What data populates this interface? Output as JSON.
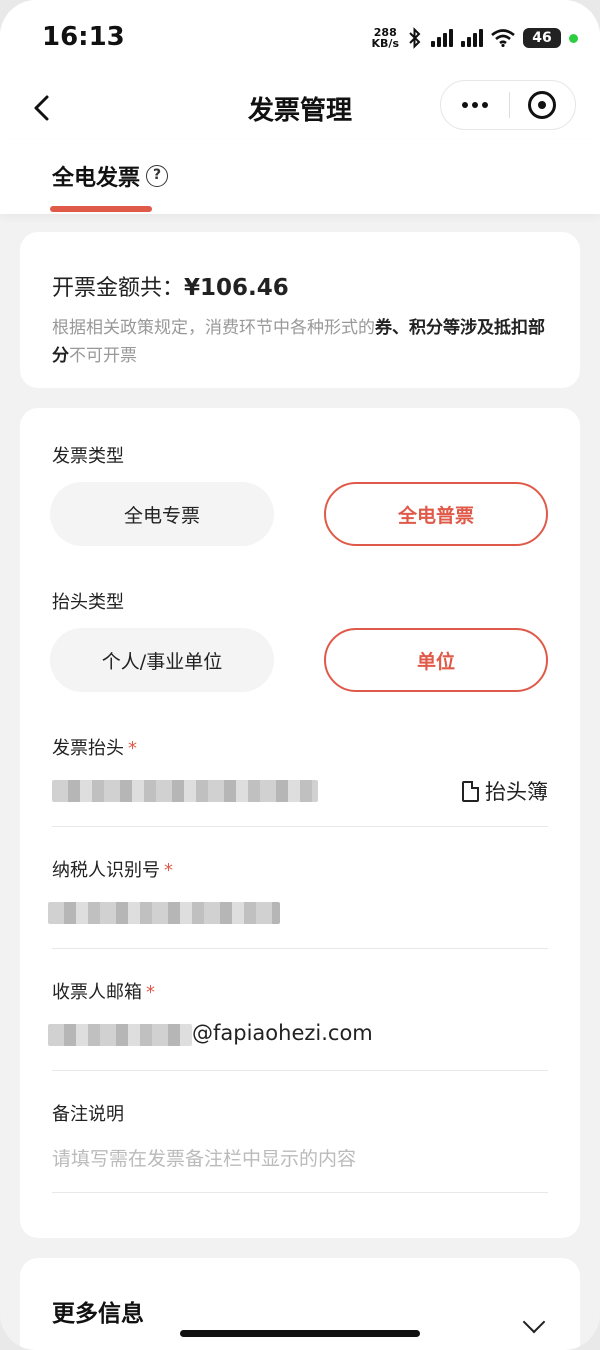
{
  "status_bar": {
    "time": "16:13",
    "net_speed_value": "288",
    "net_speed_unit": "KB/s",
    "battery": "46"
  },
  "nav": {
    "title": "发票管理"
  },
  "tab": {
    "label": "全电发票",
    "help": "?"
  },
  "amount": {
    "label": "开票金额共：",
    "value": "¥106.46",
    "note_prefix": "根据相关政策规定，消费环节中各种形式的",
    "note_bold": "券、积分等涉及抵扣部分",
    "note_suffix": "不可开票"
  },
  "form": {
    "invoice_type": {
      "label": "发票类型",
      "options": [
        "全电专票",
        "全电普票"
      ],
      "selected": "全电普票"
    },
    "header_type": {
      "label": "抬头类型",
      "options": [
        "个人/事业单位",
        "单位"
      ],
      "selected": "单位"
    },
    "invoice_header": {
      "label": "发票抬头",
      "required": "*",
      "book_label": "抬头簿"
    },
    "taxpayer_id": {
      "label": "纳税人识别号",
      "required": "*"
    },
    "email": {
      "label": "收票人邮箱",
      "required": "*",
      "domain": "@fapiaohezi.com"
    },
    "remark": {
      "label": "备注说明",
      "placeholder": "请填写需在发票备注栏中显示的内容"
    }
  },
  "more_info": {
    "title": "更多信息"
  },
  "colors": {
    "accent": "#e05a4a"
  },
  "icons": [
    "back-arrow-icon",
    "more-dots-icon",
    "close-circle-icon",
    "help-icon",
    "book-icon",
    "chevron-down-icon",
    "bluetooth-icon",
    "signal-icon",
    "wifi-icon",
    "battery-icon"
  ]
}
